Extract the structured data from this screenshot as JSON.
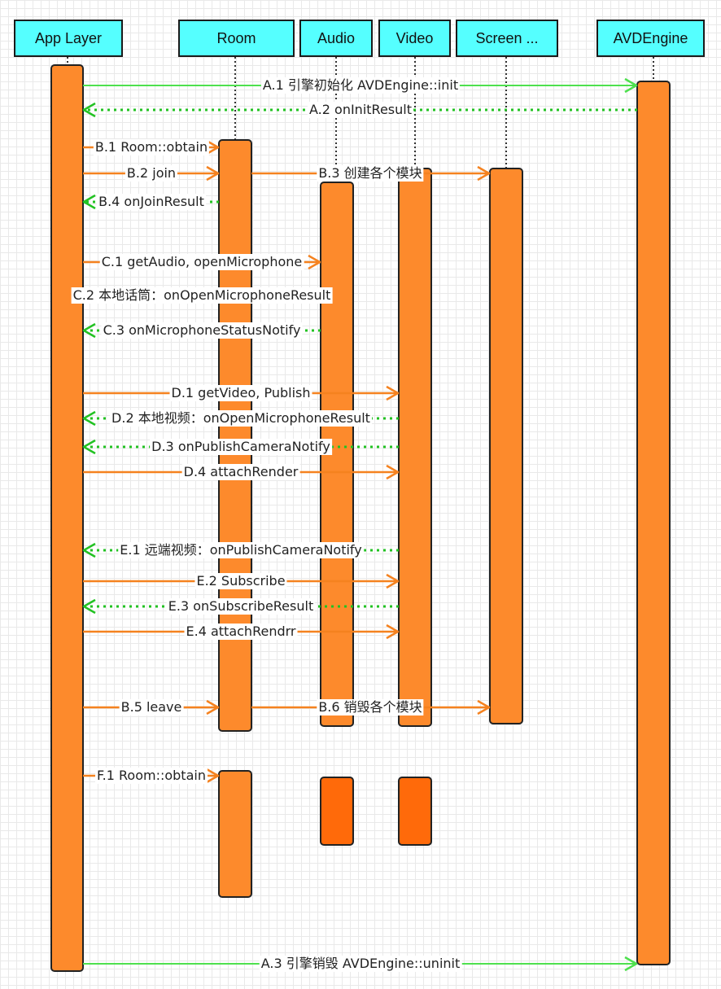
{
  "lifelines": [
    {
      "id": "app",
      "label": "App Layer"
    },
    {
      "id": "room",
      "label": "Room"
    },
    {
      "id": "audio",
      "label": "Audio"
    },
    {
      "id": "video",
      "label": "Video"
    },
    {
      "id": "screen",
      "label": "Screen  ..."
    },
    {
      "id": "engine",
      "label": "AVDEngine"
    }
  ],
  "colors": {
    "header_fill": "#55ffff",
    "activation": "#fd8a2c",
    "activation_dark": "#ff6a0a",
    "call_green": "#4ee04e",
    "return_green": "#22c222",
    "call_orange": "#f5821f",
    "grid": "#e9e9e9"
  },
  "messages": [
    {
      "id": "A.1",
      "text": "A.1 引擎初始化 AVDEngine::init",
      "from": "app",
      "to": "engine",
      "kind": "call",
      "color": "green"
    },
    {
      "id": "A.2",
      "text": "A.2 onInitResult",
      "from": "engine",
      "to": "app",
      "kind": "return"
    },
    {
      "id": "B.1",
      "text": "B.1 Room::obtain",
      "from": "app",
      "to": "room",
      "kind": "call",
      "color": "orange"
    },
    {
      "id": "B.2",
      "text": "B.2 join",
      "from": "app",
      "to": "room",
      "kind": "call",
      "color": "orange"
    },
    {
      "id": "B.3",
      "text": "B.3 创建各个模块",
      "from": "room",
      "to": "screen",
      "kind": "call",
      "color": "orange"
    },
    {
      "id": "B.4",
      "text": "B.4 onJoinResult",
      "from": "room",
      "to": "app",
      "kind": "return"
    },
    {
      "id": "C.1",
      "text": "C.1 getAudio, openMicrophone",
      "from": "app",
      "to": "audio",
      "kind": "call",
      "color": "orange"
    },
    {
      "id": "C.2",
      "text": "C.2 本地话筒：onOpenMicrophoneResult",
      "from": "audio",
      "to": "app",
      "kind": "note"
    },
    {
      "id": "C.3",
      "text": "C.3 onMicrophoneStatusNotify",
      "from": "audio",
      "to": "app",
      "kind": "return"
    },
    {
      "id": "D.1",
      "text": "D.1 getVideo, Publish",
      "from": "app",
      "to": "video",
      "kind": "call",
      "color": "orange"
    },
    {
      "id": "D.2",
      "text": "D.2 本地视频：onOpenMicrophoneResult",
      "from": "video",
      "to": "app",
      "kind": "return"
    },
    {
      "id": "D.3",
      "text": "D.3 onPublishCameraNotify",
      "from": "video",
      "to": "app",
      "kind": "return"
    },
    {
      "id": "D.4",
      "text": "D.4 attachRender",
      "from": "app",
      "to": "video",
      "kind": "call",
      "color": "orange"
    },
    {
      "id": "E.1",
      "text": "E.1 远端视频：onPublishCameraNotify",
      "from": "video",
      "to": "app",
      "kind": "return"
    },
    {
      "id": "E.2",
      "text": "E.2 Subscribe",
      "from": "app",
      "to": "video",
      "kind": "call",
      "color": "orange"
    },
    {
      "id": "E.3",
      "text": "E.3 onSubscribeResult",
      "from": "video",
      "to": "app",
      "kind": "return"
    },
    {
      "id": "E.4",
      "text": "E.4 attachRendrr",
      "from": "app",
      "to": "video",
      "kind": "call",
      "color": "orange"
    },
    {
      "id": "B.5",
      "text": "B.5 leave",
      "from": "app",
      "to": "room",
      "kind": "call",
      "color": "orange"
    },
    {
      "id": "B.6",
      "text": "B.6 销毁各个模块",
      "from": "room",
      "to": "screen",
      "kind": "call",
      "color": "orange"
    },
    {
      "id": "F.1",
      "text": "F.1 Room::obtain",
      "from": "app",
      "to": "room",
      "kind": "call",
      "color": "orange"
    },
    {
      "id": "A.3",
      "text": "A.3 引擎销毁 AVDEngine::uninit",
      "from": "app",
      "to": "engine",
      "kind": "call",
      "color": "green"
    }
  ]
}
